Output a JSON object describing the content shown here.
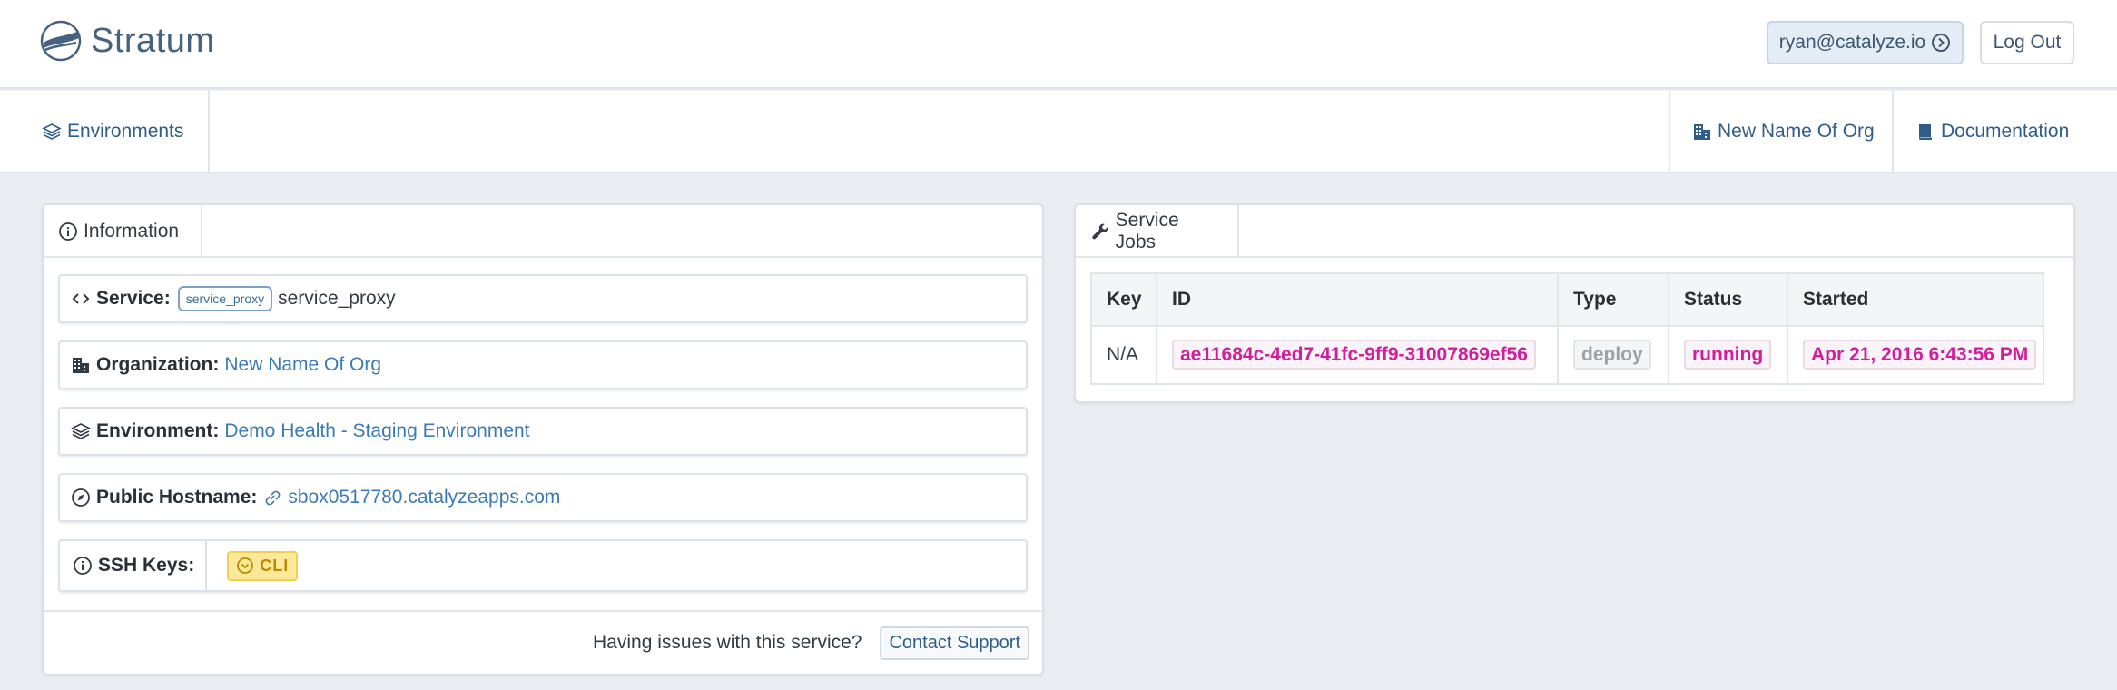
{
  "app": {
    "name": "Stratum"
  },
  "header": {
    "user_email": "ryan@catalyze.io",
    "logout_label": "Log Out"
  },
  "nav": {
    "environments": "Environments",
    "org": "New Name Of Org",
    "docs": "Documentation"
  },
  "info_panel": {
    "tab_label": "Information",
    "service_label": "Service:",
    "service_badge": "service_proxy",
    "service_value": "service_proxy",
    "org_label": "Organization:",
    "org_value": "New Name Of Org",
    "env_label": "Environment:",
    "env_value": "Demo Health - Staging Environment",
    "host_label": "Public Hostname:",
    "host_value": "sbox0517780.catalyzeapps.com",
    "ssh_label": "SSH Keys:",
    "ssh_badge": "CLI",
    "footer_text": "Having issues with this service?",
    "support_label": "Contact Support"
  },
  "jobs_panel": {
    "tab_label": "Service Jobs",
    "columns": [
      "Key",
      "ID",
      "Type",
      "Status",
      "Started"
    ],
    "rows": [
      {
        "key": "N/A",
        "id": "ae11684c-4ed7-41fc-9ff9-31007869ef56",
        "type": "deploy",
        "status": "running",
        "started": "Apr 21, 2016 6:43:56 PM"
      }
    ]
  },
  "colors": {
    "accent": "#2f5d8a",
    "link": "#3a7ab8",
    "code": "#d21e9d",
    "badge": "#fbe89a"
  }
}
